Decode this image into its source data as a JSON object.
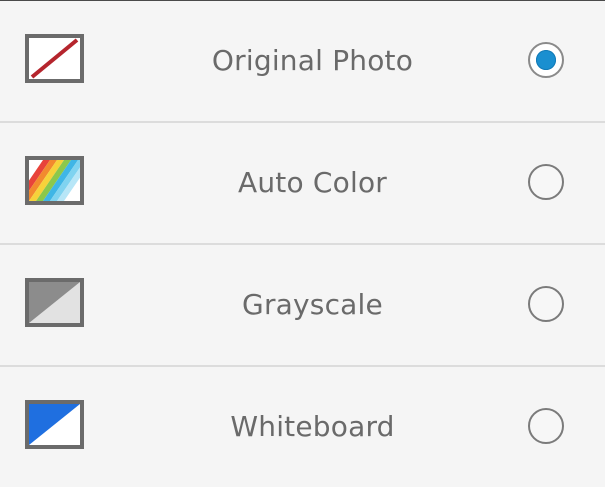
{
  "colors": {
    "accent": "#1a8fd0",
    "label": "#6a6a6a",
    "divider": "#dcdcdc",
    "background": "#f5f5f5"
  },
  "options": [
    {
      "label": "Original Photo",
      "icon": "original-photo-icon",
      "selected": true
    },
    {
      "label": "Auto Color",
      "icon": "auto-color-icon",
      "selected": false
    },
    {
      "label": "Grayscale",
      "icon": "grayscale-icon",
      "selected": false
    },
    {
      "label": "Whiteboard",
      "icon": "whiteboard-icon",
      "selected": false
    }
  ]
}
